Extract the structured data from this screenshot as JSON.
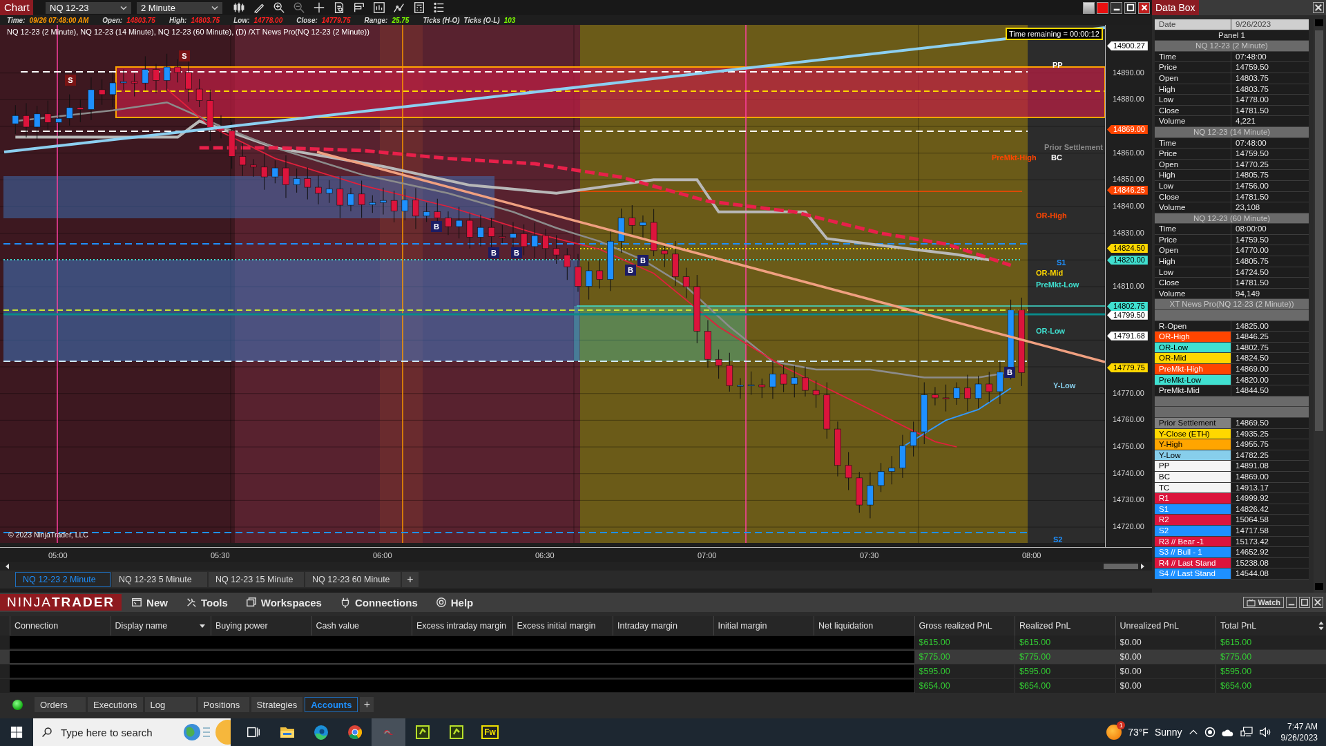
{
  "chart_window": {
    "title": "Chart",
    "instrument": "NQ 12-23",
    "interval": "2 Minute",
    "info": [
      {
        "label": "Time:",
        "value": "09/26 07:48:00 AM",
        "color": "#ff9900"
      },
      {
        "label": "Open:",
        "value": "14803.75",
        "color": "#ff2020"
      },
      {
        "label": "High:",
        "value": "14803.75",
        "color": "#ff2020"
      },
      {
        "label": "Low:",
        "value": "14778.00",
        "color": "#ff2020"
      },
      {
        "label": "Close:",
        "value": "14779.75",
        "color": "#ff2020"
      },
      {
        "label": "Range:",
        "value": "25.75",
        "color": "#7cfc00"
      },
      {
        "label": "Ticks (H-O)"
      },
      {
        "label": "Ticks (O-L)",
        "value": "103",
        "color": "#7cfc00"
      }
    ],
    "legend": "NQ 12-23 (2 Minute), NQ 12-23 (14 Minute), NQ 12-23 (60 Minute), (D) /XT News Pro(NQ 12-23 (2 Minute))",
    "time_remaining": "Time remaining = 00:00:12",
    "copyright": "© 2023 NinjaTrader, LLC",
    "level_labels": [
      {
        "text": "PP",
        "color": "#ffffff"
      },
      {
        "text": "Prior Settlement",
        "color": "#8a8a8a"
      },
      {
        "text": "PreMkt-High",
        "color": "#ff4500"
      },
      {
        "text": "BC",
        "color": "#ffffff"
      },
      {
        "text": "OR-High",
        "color": "#ff4500"
      },
      {
        "text": "S1",
        "color": "#1e90ff"
      },
      {
        "text": "OR-Mid",
        "color": "#ffd700"
      },
      {
        "text": "PreMkt-Low",
        "color": "#40e0d0"
      },
      {
        "text": "OR-Low",
        "color": "#40e0d0"
      },
      {
        "text": "Y-Low",
        "color": "#87ceeb"
      },
      {
        "text": "S2",
        "color": "#1e90ff"
      }
    ],
    "markers": [
      {
        "text": "S",
        "kind": "sell"
      },
      {
        "text": "S",
        "kind": "sell"
      },
      {
        "text": "B",
        "kind": "buy"
      },
      {
        "text": "B",
        "kind": "buy"
      },
      {
        "text": "B",
        "kind": "buy"
      },
      {
        "text": "B",
        "kind": "buy"
      },
      {
        "text": "B",
        "kind": "buy"
      },
      {
        "text": "B",
        "kind": "buy"
      }
    ],
    "price_axis": [
      "14890.00",
      "14880.00",
      "14860.00",
      "14850.00",
      "14840.00",
      "14830.00",
      "14810.00",
      "14770.00",
      "14760.00",
      "14750.00",
      "14740.00",
      "14730.00",
      "14720.00"
    ],
    "price_flags": [
      {
        "text": "14900.27",
        "color": "#ffffff"
      },
      {
        "text": "14869.00",
        "color": "#ff4500"
      },
      {
        "text": "14846.25",
        "color": "#ff4500"
      },
      {
        "text": "14824.50",
        "color": "#ffd700"
      },
      {
        "text": "14820.00",
        "color": "#40e0d0"
      },
      {
        "text": "14802.75",
        "color": "#40e0d0"
      },
      {
        "text": "14799.50",
        "color": "#ffffff"
      },
      {
        "text": "14791.68",
        "color": "#ffffff"
      },
      {
        "text": "14779.75",
        "color": "#ffd700"
      }
    ],
    "time_axis": [
      "05:00",
      "05:30",
      "06:00",
      "06:30",
      "07:00",
      "07:30",
      "08:00"
    ],
    "tabs": [
      {
        "label": "NQ 12-23 2 Minute",
        "selected": true
      },
      {
        "label": "NQ 12-23 5 Minute",
        "selected": false
      },
      {
        "label": "NQ 12-23 15 Minute",
        "selected": false
      },
      {
        "label": "NQ 12-23 60 Minute",
        "selected": false
      }
    ],
    "add_tab": "+"
  },
  "data_box": {
    "title": "Data Box",
    "date": {
      "label": "Date",
      "value": "9/26/2023"
    },
    "panel": "Panel 1",
    "sections": [
      {
        "title": "NQ 12-23 (2 Minute)",
        "rows": [
          {
            "kind": "value",
            "label": "Time",
            "value": "07:48:00"
          },
          {
            "kind": "value",
            "label": "Price",
            "value": "14759.50"
          },
          {
            "kind": "value",
            "label": "Open",
            "value": "14803.75"
          },
          {
            "kind": "value",
            "label": "High",
            "value": "14803.75"
          },
          {
            "kind": "value",
            "label": "Low",
            "value": "14778.00"
          },
          {
            "kind": "value",
            "label": "Close",
            "value": "14781.50"
          },
          {
            "kind": "value",
            "label": "Volume",
            "value": "4,221"
          }
        ]
      },
      {
        "title": "NQ 12-23 (14 Minute)",
        "rows": [
          {
            "kind": "value",
            "label": "Time",
            "value": "07:48:00"
          },
          {
            "kind": "value",
            "label": "Price",
            "value": "14759.50"
          },
          {
            "kind": "value",
            "label": "Open",
            "value": "14770.25"
          },
          {
            "kind": "value",
            "label": "High",
            "value": "14805.75"
          },
          {
            "kind": "value",
            "label": "Low",
            "value": "14756.00"
          },
          {
            "kind": "value",
            "label": "Close",
            "value": "14781.50"
          },
          {
            "kind": "value",
            "label": "Volume",
            "value": "23,108"
          }
        ]
      },
      {
        "title": "NQ 12-23 (60 Minute)",
        "rows": [
          {
            "kind": "value",
            "label": "Time",
            "value": "08:00:00"
          },
          {
            "kind": "value",
            "label": "Price",
            "value": "14759.50"
          },
          {
            "kind": "value",
            "label": "Open",
            "value": "14770.00"
          },
          {
            "kind": "value",
            "label": "High",
            "value": "14805.75"
          },
          {
            "kind": "value",
            "label": "Low",
            "value": "14724.50"
          },
          {
            "kind": "value",
            "label": "Close",
            "value": "14781.50"
          },
          {
            "kind": "value",
            "label": "Volume",
            "value": "94,149"
          }
        ]
      },
      {
        "title": "XT News Pro(NQ 12-23 (2 Minute))",
        "rows": [
          {
            "kind": "spacer"
          },
          {
            "kind": "value",
            "label": "R-Open",
            "value": "14825.00"
          },
          {
            "kind": "value",
            "label": "OR-High",
            "value": "14846.25",
            "color": "#ff4500"
          },
          {
            "kind": "value",
            "label": "OR-Low",
            "value": "14802.75",
            "color": "#40e0d0"
          },
          {
            "kind": "value",
            "label": "OR-Mid",
            "value": "14824.50",
            "color": "#ffd700"
          },
          {
            "kind": "value",
            "label": "PreMkt-High",
            "value": "14869.00",
            "color": "#ff4500"
          },
          {
            "kind": "value",
            "label": "PreMkt-Low",
            "value": "14820.00",
            "color": "#40e0d0"
          },
          {
            "kind": "value",
            "label": "PreMkt-Mid",
            "value": "14844.50"
          },
          {
            "kind": "spacer"
          },
          {
            "kind": "spacer"
          },
          {
            "kind": "value",
            "label": "Prior Settlement",
            "value": "14869.50",
            "color": "#808080"
          },
          {
            "kind": "value",
            "label": "Y-Close (ETH)",
            "value": "14935.25",
            "color": "#ffd700"
          },
          {
            "kind": "value",
            "label": "Y-High",
            "value": "14955.75",
            "color": "#ffa500"
          },
          {
            "kind": "value",
            "label": "Y-Low",
            "value": "14782.25",
            "color": "#87ceeb"
          },
          {
            "kind": "value",
            "label": "PP",
            "value": "14891.08",
            "color": "#f5f5f5"
          },
          {
            "kind": "value",
            "label": "BC",
            "value": "14869.00",
            "color": "#f5f5f5"
          },
          {
            "kind": "value",
            "label": "TC",
            "value": "14913.17",
            "color": "#f5f5f5"
          },
          {
            "kind": "value",
            "label": "R1",
            "value": "14999.92",
            "color": "#dc143c"
          },
          {
            "kind": "value",
            "label": "S1",
            "value": "14826.42",
            "color": "#1e90ff"
          },
          {
            "kind": "value",
            "label": "R2",
            "value": "15064.58",
            "color": "#dc143c"
          },
          {
            "kind": "value",
            "label": "S2",
            "value": "14717.58",
            "color": "#1e90ff"
          },
          {
            "kind": "value",
            "label": "R3 // Bear -1",
            "value": "15173.42",
            "color": "#dc143c"
          },
          {
            "kind": "value",
            "label": "S3 // Bull - 1",
            "value": "14652.92",
            "color": "#1e90ff"
          },
          {
            "kind": "value",
            "label": "R4 // Last Stand",
            "value": "15238.08",
            "color": "#dc143c"
          },
          {
            "kind": "value",
            "label": "S4 // Last Stand",
            "value": "14544.08",
            "color": "#1e90ff"
          }
        ]
      }
    ]
  },
  "control_center": {
    "logo": "NINJA**TRADER**",
    "menu": [
      "New",
      "Tools",
      "Workspaces",
      "Connections",
      "Help"
    ],
    "watch": "Watch",
    "columns": [
      "Connection",
      "Display name",
      "Buying power",
      "Cash value",
      "Excess intraday margin",
      "Excess initial margin",
      "Intraday margin",
      "Initial margin",
      "Net liquidation",
      "Gross realized PnL",
      "Realized PnL",
      "Unrealized PnL",
      "Total PnL"
    ],
    "rows": [
      {
        "selected": false,
        "cells": [
          {
            "text": "$615.00",
            "positive": true
          },
          {
            "text": "$615.00",
            "positive": true
          },
          {
            "text": "$0.00",
            "positive": false
          },
          {
            "text": "$615.00",
            "positive": true
          }
        ]
      },
      {
        "selected": true,
        "cells": [
          {
            "text": "$775.00",
            "positive": true
          },
          {
            "text": "$775.00",
            "positive": true
          },
          {
            "text": "$0.00",
            "positive": false
          },
          {
            "text": "$775.00",
            "positive": true
          }
        ]
      },
      {
        "selected": false,
        "cells": [
          {
            "text": "$595.00",
            "positive": true
          },
          {
            "text": "$595.00",
            "positive": true
          },
          {
            "text": "$0.00",
            "positive": false
          },
          {
            "text": "$595.00",
            "positive": true
          }
        ]
      },
      {
        "selected": false,
        "cells": [
          {
            "text": "$654.00",
            "positive": true
          },
          {
            "text": "$654.00",
            "positive": true
          },
          {
            "text": "$0.00",
            "positive": false
          },
          {
            "text": "$654.00",
            "positive": true
          }
        ]
      }
    ],
    "tabs": [
      {
        "label": "Orders",
        "selected": false
      },
      {
        "label": "Executions",
        "selected": false
      },
      {
        "label": "Log",
        "selected": false
      },
      {
        "label": "Positions",
        "selected": false
      },
      {
        "label": "Strategies",
        "selected": false
      },
      {
        "label": "Accounts",
        "selected": true
      }
    ],
    "add_tab": "+"
  },
  "taskbar": {
    "search": {
      "placeholder": "Type here to search"
    },
    "apps": [
      {
        "kind": "taskview",
        "selected": false
      },
      {
        "kind": "folder",
        "selected": false
      },
      {
        "kind": "edge",
        "selected": false
      },
      {
        "kind": "chrome",
        "selected": false
      },
      {
        "kind": "ninja",
        "selected": true
      },
      {
        "kind": "green",
        "selected": false
      },
      {
        "kind": "green",
        "selected": false
      },
      {
        "kind": "fw",
        "label": "Fw",
        "selected": false
      }
    ],
    "weather_badge": "1",
    "temperature": "73°F",
    "weather": "Sunny",
    "time": "7:47 AM",
    "date": "9/26/2023"
  }
}
